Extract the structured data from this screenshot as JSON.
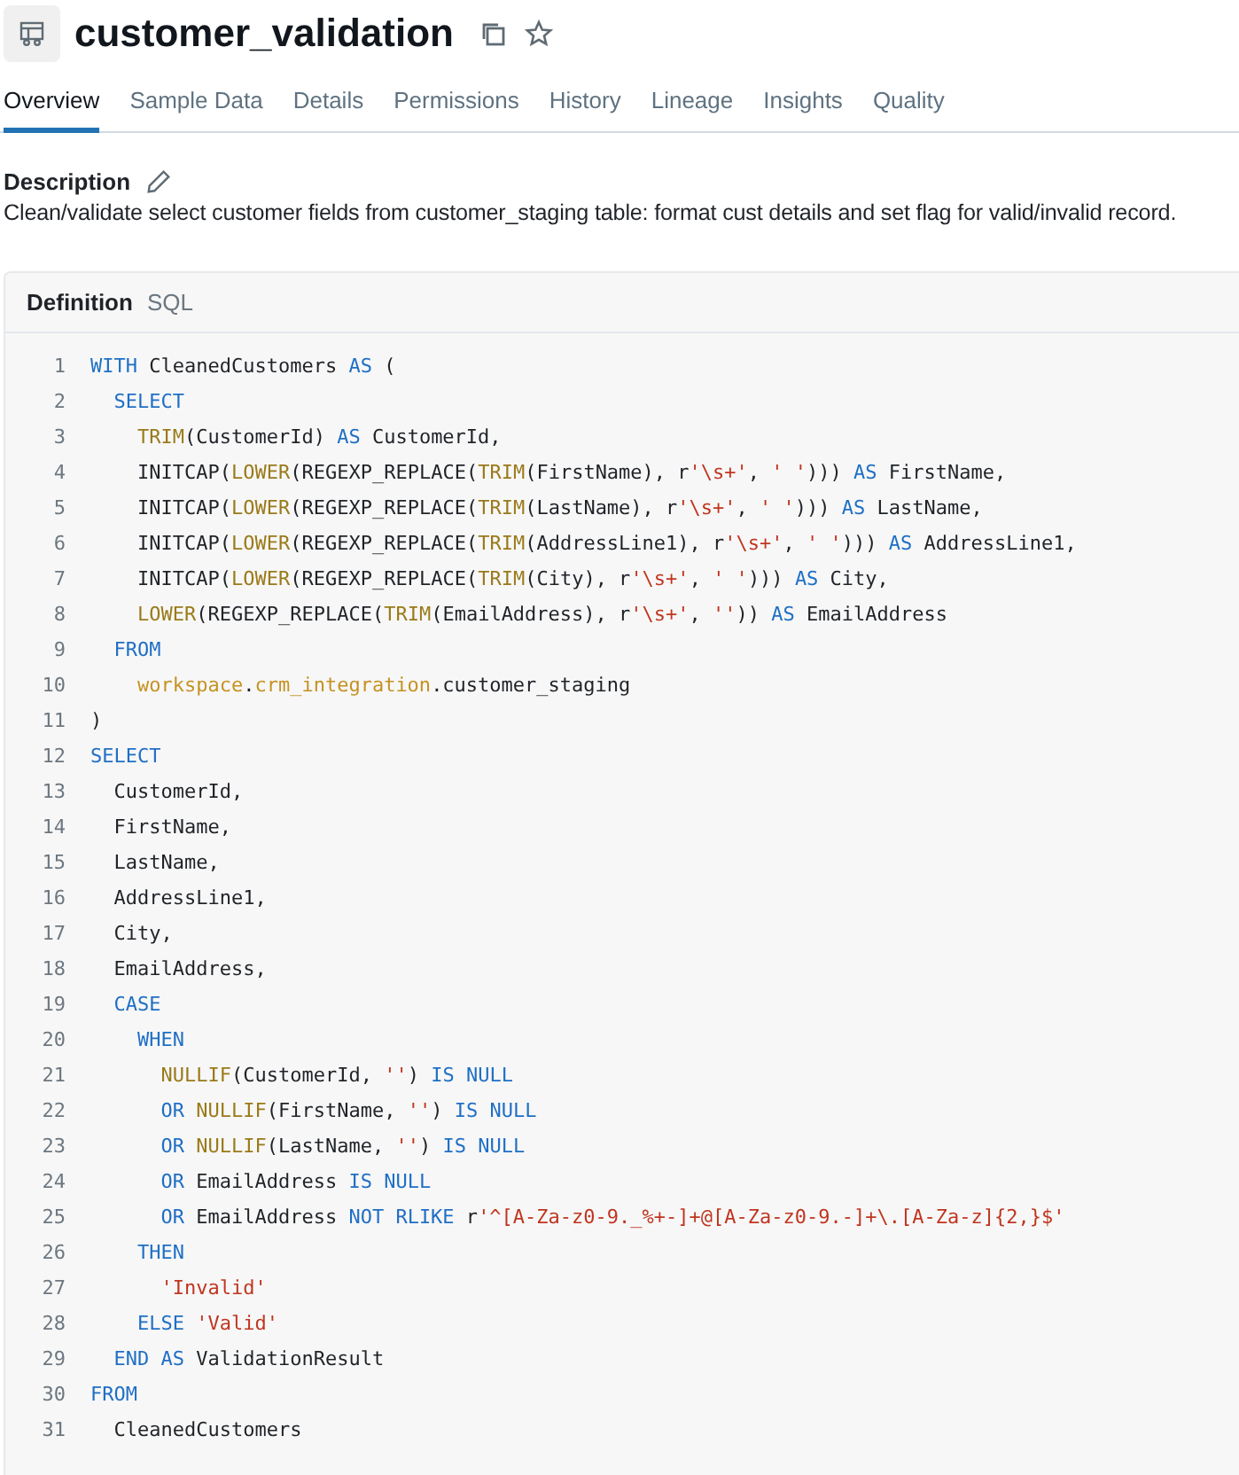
{
  "title": "customer_validation",
  "tabs": [
    {
      "label": "Overview",
      "selected": true
    },
    {
      "label": "Sample Data",
      "selected": false
    },
    {
      "label": "Details",
      "selected": false
    },
    {
      "label": "Permissions",
      "selected": false
    },
    {
      "label": "History",
      "selected": false
    },
    {
      "label": "Lineage",
      "selected": false
    },
    {
      "label": "Insights",
      "selected": false
    },
    {
      "label": "Quality",
      "selected": false
    }
  ],
  "description": {
    "label": "Description",
    "text": "Clean/validate select customer fields from customer_staging table: format cust details and set flag for valid/invalid record."
  },
  "definition": {
    "title": "Definition",
    "language": "SQL",
    "lines": [
      {
        "number": "1",
        "tokens": [
          {
            "kind": "keyword",
            "text": "WITH"
          },
          {
            "kind": "plain",
            "text": " CleanedCustomers "
          },
          {
            "kind": "keyword",
            "text": "AS"
          },
          {
            "kind": "plain",
            "text": " ("
          }
        ]
      },
      {
        "number": "2",
        "tokens": [
          {
            "kind": "keyword",
            "text": "  SELECT"
          }
        ]
      },
      {
        "number": "3",
        "tokens": [
          {
            "kind": "function",
            "text": "    TRIM"
          },
          {
            "kind": "plain",
            "text": "(CustomerId) "
          },
          {
            "kind": "keyword",
            "text": "AS"
          },
          {
            "kind": "plain",
            "text": " CustomerId,"
          }
        ]
      },
      {
        "number": "4",
        "tokens": [
          {
            "kind": "plain",
            "text": "    INITCAP("
          },
          {
            "kind": "function",
            "text": "LOWER"
          },
          {
            "kind": "plain",
            "text": "(REGEXP_REPLACE("
          },
          {
            "kind": "function",
            "text": "TRIM"
          },
          {
            "kind": "plain",
            "text": "(FirstName), r"
          },
          {
            "kind": "string",
            "text": "'\\s+'"
          },
          {
            "kind": "plain",
            "text": ", "
          },
          {
            "kind": "string",
            "text": "' '"
          },
          {
            "kind": "plain",
            "text": "))) "
          },
          {
            "kind": "keyword",
            "text": "AS"
          },
          {
            "kind": "plain",
            "text": " FirstName,"
          }
        ]
      },
      {
        "number": "5",
        "tokens": [
          {
            "kind": "plain",
            "text": "    INITCAP("
          },
          {
            "kind": "function",
            "text": "LOWER"
          },
          {
            "kind": "plain",
            "text": "(REGEXP_REPLACE("
          },
          {
            "kind": "function",
            "text": "TRIM"
          },
          {
            "kind": "plain",
            "text": "(LastName), r"
          },
          {
            "kind": "string",
            "text": "'\\s+'"
          },
          {
            "kind": "plain",
            "text": ", "
          },
          {
            "kind": "string",
            "text": "' '"
          },
          {
            "kind": "plain",
            "text": "))) "
          },
          {
            "kind": "keyword",
            "text": "AS"
          },
          {
            "kind": "plain",
            "text": " LastName,"
          }
        ]
      },
      {
        "number": "6",
        "tokens": [
          {
            "kind": "plain",
            "text": "    INITCAP("
          },
          {
            "kind": "function",
            "text": "LOWER"
          },
          {
            "kind": "plain",
            "text": "(REGEXP_REPLACE("
          },
          {
            "kind": "function",
            "text": "TRIM"
          },
          {
            "kind": "plain",
            "text": "(AddressLine1), r"
          },
          {
            "kind": "string",
            "text": "'\\s+'"
          },
          {
            "kind": "plain",
            "text": ", "
          },
          {
            "kind": "string",
            "text": "' '"
          },
          {
            "kind": "plain",
            "text": "))) "
          },
          {
            "kind": "keyword",
            "text": "AS"
          },
          {
            "kind": "plain",
            "text": " AddressLine1,"
          }
        ]
      },
      {
        "number": "7",
        "tokens": [
          {
            "kind": "plain",
            "text": "    INITCAP("
          },
          {
            "kind": "function",
            "text": "LOWER"
          },
          {
            "kind": "plain",
            "text": "(REGEXP_REPLACE("
          },
          {
            "kind": "function",
            "text": "TRIM"
          },
          {
            "kind": "plain",
            "text": "(City), r"
          },
          {
            "kind": "string",
            "text": "'\\s+'"
          },
          {
            "kind": "plain",
            "text": ", "
          },
          {
            "kind": "string",
            "text": "' '"
          },
          {
            "kind": "plain",
            "text": "))) "
          },
          {
            "kind": "keyword",
            "text": "AS"
          },
          {
            "kind": "plain",
            "text": " City,"
          }
        ]
      },
      {
        "number": "8",
        "tokens": [
          {
            "kind": "function",
            "text": "    LOWER"
          },
          {
            "kind": "plain",
            "text": "(REGEXP_REPLACE("
          },
          {
            "kind": "function",
            "text": "TRIM"
          },
          {
            "kind": "plain",
            "text": "(EmailAddress), r"
          },
          {
            "kind": "string",
            "text": "'\\s+'"
          },
          {
            "kind": "plain",
            "text": ", "
          },
          {
            "kind": "string",
            "text": "''"
          },
          {
            "kind": "plain",
            "text": ")) "
          },
          {
            "kind": "keyword",
            "text": "AS"
          },
          {
            "kind": "plain",
            "text": " EmailAddress"
          }
        ]
      },
      {
        "number": "9",
        "tokens": [
          {
            "kind": "keyword",
            "text": "  FROM"
          }
        ]
      },
      {
        "number": "10",
        "tokens": [
          {
            "kind": "schema",
            "text": "    workspace"
          },
          {
            "kind": "plain",
            "text": "."
          },
          {
            "kind": "schema",
            "text": "crm_integration"
          },
          {
            "kind": "plain",
            "text": ".customer_staging"
          }
        ]
      },
      {
        "number": "11",
        "tokens": [
          {
            "kind": "plain",
            "text": ")"
          }
        ]
      },
      {
        "number": "12",
        "tokens": [
          {
            "kind": "keyword",
            "text": "SELECT"
          }
        ]
      },
      {
        "number": "13",
        "tokens": [
          {
            "kind": "plain",
            "text": "  CustomerId,"
          }
        ]
      },
      {
        "number": "14",
        "tokens": [
          {
            "kind": "plain",
            "text": "  FirstName,"
          }
        ]
      },
      {
        "number": "15",
        "tokens": [
          {
            "kind": "plain",
            "text": "  LastName,"
          }
        ]
      },
      {
        "number": "16",
        "tokens": [
          {
            "kind": "plain",
            "text": "  AddressLine1,"
          }
        ]
      },
      {
        "number": "17",
        "tokens": [
          {
            "kind": "plain",
            "text": "  City,"
          }
        ]
      },
      {
        "number": "18",
        "tokens": [
          {
            "kind": "plain",
            "text": "  EmailAddress,"
          }
        ]
      },
      {
        "number": "19",
        "tokens": [
          {
            "kind": "keyword",
            "text": "  CASE"
          }
        ]
      },
      {
        "number": "20",
        "tokens": [
          {
            "kind": "keyword",
            "text": "    WHEN"
          }
        ]
      },
      {
        "number": "21",
        "tokens": [
          {
            "kind": "function",
            "text": "      NULLIF"
          },
          {
            "kind": "plain",
            "text": "(CustomerId, "
          },
          {
            "kind": "string",
            "text": "''"
          },
          {
            "kind": "plain",
            "text": ") "
          },
          {
            "kind": "keyword",
            "text": "IS NULL"
          }
        ]
      },
      {
        "number": "22",
        "tokens": [
          {
            "kind": "keyword",
            "text": "      OR "
          },
          {
            "kind": "function",
            "text": "NULLIF"
          },
          {
            "kind": "plain",
            "text": "(FirstName, "
          },
          {
            "kind": "string",
            "text": "''"
          },
          {
            "kind": "plain",
            "text": ") "
          },
          {
            "kind": "keyword",
            "text": "IS NULL"
          }
        ]
      },
      {
        "number": "23",
        "tokens": [
          {
            "kind": "keyword",
            "text": "      OR "
          },
          {
            "kind": "function",
            "text": "NULLIF"
          },
          {
            "kind": "plain",
            "text": "(LastName, "
          },
          {
            "kind": "string",
            "text": "''"
          },
          {
            "kind": "plain",
            "text": ") "
          },
          {
            "kind": "keyword",
            "text": "IS NULL"
          }
        ]
      },
      {
        "number": "24",
        "tokens": [
          {
            "kind": "keyword",
            "text": "      OR"
          },
          {
            "kind": "plain",
            "text": " EmailAddress "
          },
          {
            "kind": "keyword",
            "text": "IS NULL"
          }
        ]
      },
      {
        "number": "25",
        "tokens": [
          {
            "kind": "keyword",
            "text": "      OR"
          },
          {
            "kind": "plain",
            "text": " EmailAddress "
          },
          {
            "kind": "keyword",
            "text": "NOT RLIKE"
          },
          {
            "kind": "plain",
            "text": " r"
          },
          {
            "kind": "string",
            "text": "'^[A-Za-z0-9._%+-]+@[A-Za-z0-9.-]+\\.[A-Za-z]{2,}$'"
          }
        ]
      },
      {
        "number": "26",
        "tokens": [
          {
            "kind": "keyword",
            "text": "    THEN"
          }
        ]
      },
      {
        "number": "27",
        "tokens": [
          {
            "kind": "string",
            "text": "      'Invalid'"
          }
        ]
      },
      {
        "number": "28",
        "tokens": [
          {
            "kind": "keyword",
            "text": "    ELSE "
          },
          {
            "kind": "string",
            "text": "'Valid'"
          }
        ]
      },
      {
        "number": "29",
        "tokens": [
          {
            "kind": "keyword",
            "text": "  END AS"
          },
          {
            "kind": "plain",
            "text": " ValidationResult"
          }
        ]
      },
      {
        "number": "30",
        "tokens": [
          {
            "kind": "keyword",
            "text": "FROM"
          }
        ]
      },
      {
        "number": "31",
        "tokens": [
          {
            "kind": "plain",
            "text": "  CleanedCustomers"
          }
        ]
      }
    ]
  }
}
